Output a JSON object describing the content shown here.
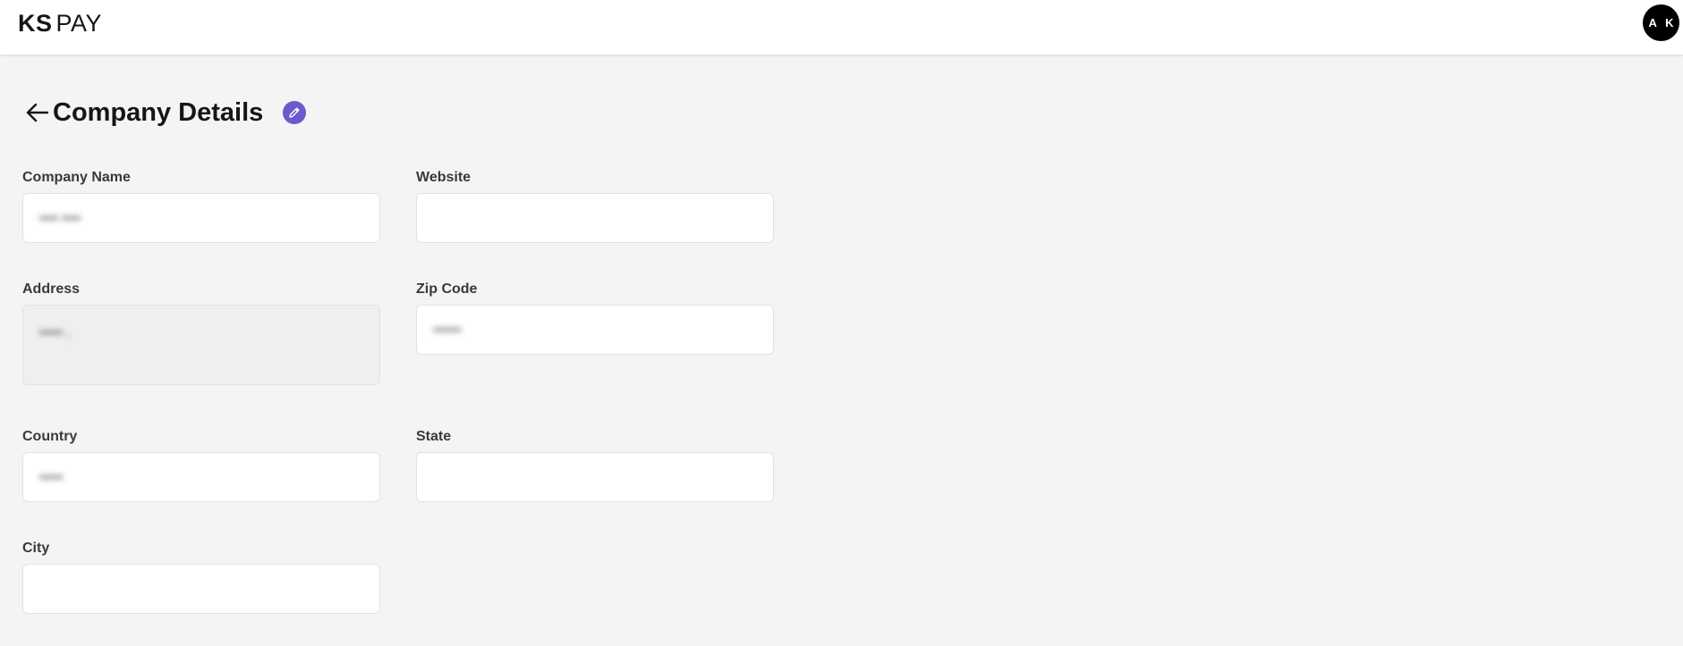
{
  "brand": {
    "bold": "KS",
    "light": "PAY"
  },
  "user": {
    "initials": "A K"
  },
  "page": {
    "title": "Company Details"
  },
  "fields": {
    "company_name": {
      "label": "Company Name",
      "value": "•••• ••••"
    },
    "website": {
      "label": "Website",
      "value": ""
    },
    "address": {
      "label": "Address",
      "value": "••••• ,"
    },
    "zip_code": {
      "label": "Zip Code",
      "value": "••••••"
    },
    "country": {
      "label": "Country",
      "value": "•••••"
    },
    "state": {
      "label": "State",
      "value": ""
    },
    "city": {
      "label": "City",
      "value": ""
    }
  },
  "icons": {
    "back": "arrow-left-icon",
    "edit": "pencil-icon"
  },
  "colors": {
    "accent": "#6a5acd",
    "background": "#f4f4f4"
  }
}
